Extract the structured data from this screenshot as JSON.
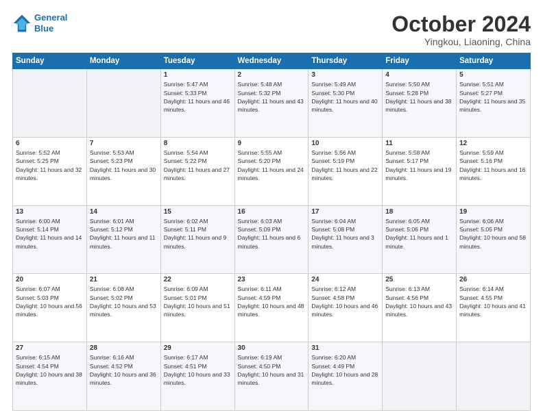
{
  "header": {
    "logo_line1": "General",
    "logo_line2": "Blue",
    "month": "October 2024",
    "location": "Yingkou, Liaoning, China"
  },
  "weekdays": [
    "Sunday",
    "Monday",
    "Tuesday",
    "Wednesday",
    "Thursday",
    "Friday",
    "Saturday"
  ],
  "weeks": [
    [
      {
        "day": "",
        "sunrise": "",
        "sunset": "",
        "daylight": ""
      },
      {
        "day": "",
        "sunrise": "",
        "sunset": "",
        "daylight": ""
      },
      {
        "day": "1",
        "sunrise": "Sunrise: 5:47 AM",
        "sunset": "Sunset: 5:33 PM",
        "daylight": "Daylight: 11 hours and 46 minutes."
      },
      {
        "day": "2",
        "sunrise": "Sunrise: 5:48 AM",
        "sunset": "Sunset: 5:32 PM",
        "daylight": "Daylight: 11 hours and 43 minutes."
      },
      {
        "day": "3",
        "sunrise": "Sunrise: 5:49 AM",
        "sunset": "Sunset: 5:30 PM",
        "daylight": "Daylight: 11 hours and 40 minutes."
      },
      {
        "day": "4",
        "sunrise": "Sunrise: 5:50 AM",
        "sunset": "Sunset: 5:28 PM",
        "daylight": "Daylight: 11 hours and 38 minutes."
      },
      {
        "day": "5",
        "sunrise": "Sunrise: 5:51 AM",
        "sunset": "Sunset: 5:27 PM",
        "daylight": "Daylight: 11 hours and 35 minutes."
      }
    ],
    [
      {
        "day": "6",
        "sunrise": "Sunrise: 5:52 AM",
        "sunset": "Sunset: 5:25 PM",
        "daylight": "Daylight: 11 hours and 32 minutes."
      },
      {
        "day": "7",
        "sunrise": "Sunrise: 5:53 AM",
        "sunset": "Sunset: 5:23 PM",
        "daylight": "Daylight: 11 hours and 30 minutes."
      },
      {
        "day": "8",
        "sunrise": "Sunrise: 5:54 AM",
        "sunset": "Sunset: 5:22 PM",
        "daylight": "Daylight: 11 hours and 27 minutes."
      },
      {
        "day": "9",
        "sunrise": "Sunrise: 5:55 AM",
        "sunset": "Sunset: 5:20 PM",
        "daylight": "Daylight: 11 hours and 24 minutes."
      },
      {
        "day": "10",
        "sunrise": "Sunrise: 5:56 AM",
        "sunset": "Sunset: 5:19 PM",
        "daylight": "Daylight: 11 hours and 22 minutes."
      },
      {
        "day": "11",
        "sunrise": "Sunrise: 5:58 AM",
        "sunset": "Sunset: 5:17 PM",
        "daylight": "Daylight: 11 hours and 19 minutes."
      },
      {
        "day": "12",
        "sunrise": "Sunrise: 5:59 AM",
        "sunset": "Sunset: 5:16 PM",
        "daylight": "Daylight: 11 hours and 16 minutes."
      }
    ],
    [
      {
        "day": "13",
        "sunrise": "Sunrise: 6:00 AM",
        "sunset": "Sunset: 5:14 PM",
        "daylight": "Daylight: 11 hours and 14 minutes."
      },
      {
        "day": "14",
        "sunrise": "Sunrise: 6:01 AM",
        "sunset": "Sunset: 5:12 PM",
        "daylight": "Daylight: 11 hours and 11 minutes."
      },
      {
        "day": "15",
        "sunrise": "Sunrise: 6:02 AM",
        "sunset": "Sunset: 5:11 PM",
        "daylight": "Daylight: 11 hours and 9 minutes."
      },
      {
        "day": "16",
        "sunrise": "Sunrise: 6:03 AM",
        "sunset": "Sunset: 5:09 PM",
        "daylight": "Daylight: 11 hours and 6 minutes."
      },
      {
        "day": "17",
        "sunrise": "Sunrise: 6:04 AM",
        "sunset": "Sunset: 5:08 PM",
        "daylight": "Daylight: 11 hours and 3 minutes."
      },
      {
        "day": "18",
        "sunrise": "Sunrise: 6:05 AM",
        "sunset": "Sunset: 5:06 PM",
        "daylight": "Daylight: 11 hours and 1 minute."
      },
      {
        "day": "19",
        "sunrise": "Sunrise: 6:06 AM",
        "sunset": "Sunset: 5:05 PM",
        "daylight": "Daylight: 10 hours and 58 minutes."
      }
    ],
    [
      {
        "day": "20",
        "sunrise": "Sunrise: 6:07 AM",
        "sunset": "Sunset: 5:03 PM",
        "daylight": "Daylight: 10 hours and 56 minutes."
      },
      {
        "day": "21",
        "sunrise": "Sunrise: 6:08 AM",
        "sunset": "Sunset: 5:02 PM",
        "daylight": "Daylight: 10 hours and 53 minutes."
      },
      {
        "day": "22",
        "sunrise": "Sunrise: 6:09 AM",
        "sunset": "Sunset: 5:01 PM",
        "daylight": "Daylight: 10 hours and 51 minutes."
      },
      {
        "day": "23",
        "sunrise": "Sunrise: 6:11 AM",
        "sunset": "Sunset: 4:59 PM",
        "daylight": "Daylight: 10 hours and 48 minutes."
      },
      {
        "day": "24",
        "sunrise": "Sunrise: 6:12 AM",
        "sunset": "Sunset: 4:58 PM",
        "daylight": "Daylight: 10 hours and 46 minutes."
      },
      {
        "day": "25",
        "sunrise": "Sunrise: 6:13 AM",
        "sunset": "Sunset: 4:56 PM",
        "daylight": "Daylight: 10 hours and 43 minutes."
      },
      {
        "day": "26",
        "sunrise": "Sunrise: 6:14 AM",
        "sunset": "Sunset: 4:55 PM",
        "daylight": "Daylight: 10 hours and 41 minutes."
      }
    ],
    [
      {
        "day": "27",
        "sunrise": "Sunrise: 6:15 AM",
        "sunset": "Sunset: 4:54 PM",
        "daylight": "Daylight: 10 hours and 38 minutes."
      },
      {
        "day": "28",
        "sunrise": "Sunrise: 6:16 AM",
        "sunset": "Sunset: 4:52 PM",
        "daylight": "Daylight: 10 hours and 36 minutes."
      },
      {
        "day": "29",
        "sunrise": "Sunrise: 6:17 AM",
        "sunset": "Sunset: 4:51 PM",
        "daylight": "Daylight: 10 hours and 33 minutes."
      },
      {
        "day": "30",
        "sunrise": "Sunrise: 6:19 AM",
        "sunset": "Sunset: 4:50 PM",
        "daylight": "Daylight: 10 hours and 31 minutes."
      },
      {
        "day": "31",
        "sunrise": "Sunrise: 6:20 AM",
        "sunset": "Sunset: 4:49 PM",
        "daylight": "Daylight: 10 hours and 28 minutes."
      },
      {
        "day": "",
        "sunrise": "",
        "sunset": "",
        "daylight": ""
      },
      {
        "day": "",
        "sunrise": "",
        "sunset": "",
        "daylight": ""
      }
    ]
  ]
}
